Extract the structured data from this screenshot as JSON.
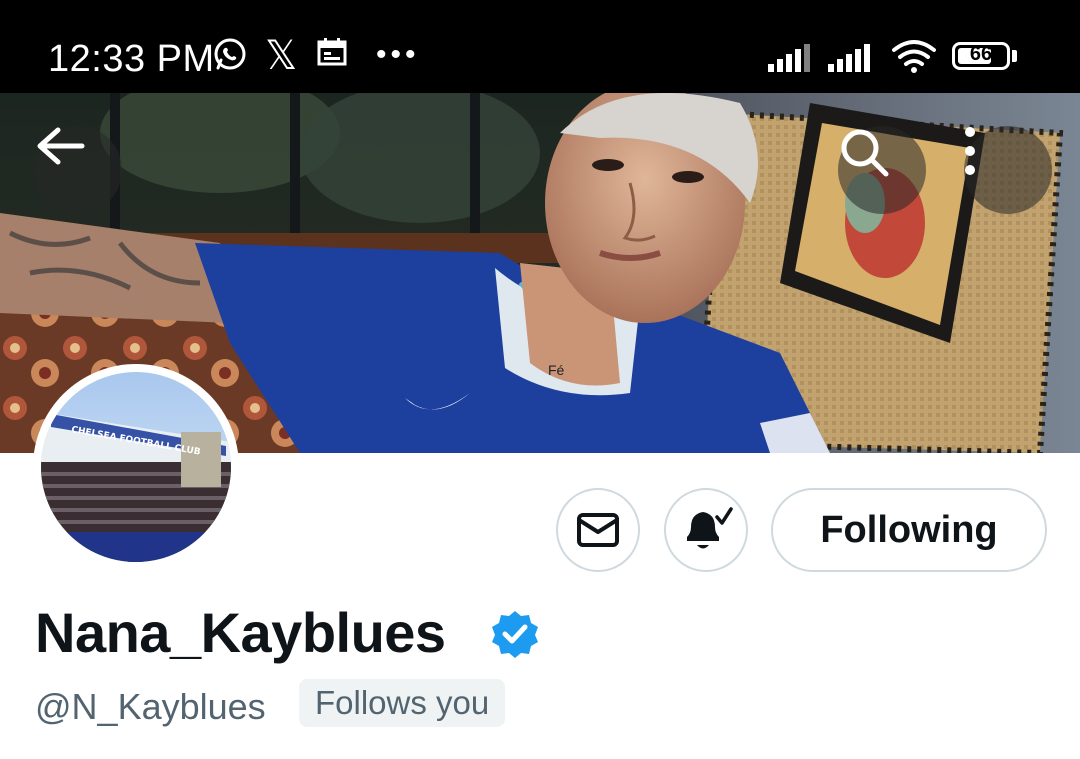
{
  "status_bar": {
    "time": "12:33 PM",
    "battery": "66",
    "icons": [
      "whatsapp-icon",
      "x-icon",
      "calendar-icon",
      "more-notifications-icon",
      "signal-icon",
      "signal-icon",
      "wifi-icon",
      "battery-icon"
    ]
  },
  "nav": {
    "back_icon": "arrow-left-icon",
    "search_icon": "search-icon",
    "more_icon": "vertical-dots-icon"
  },
  "profile": {
    "display_name": "Nana_Kayblues",
    "handle": "@N_Kayblues",
    "follows_you": "Follows you",
    "verified_color": "#1d9bf0"
  },
  "actions": {
    "message_icon": "envelope-icon",
    "notification_icon": "bell-check-icon",
    "following_label": "Following"
  },
  "avatar": {
    "stadium_text": "CHELSEA FOOTBALL CLUB"
  },
  "banner": {
    "shirt_text": "Fé"
  },
  "colors": {
    "text_primary": "#0f1419",
    "text_secondary": "#536471",
    "border": "#cfd9de",
    "badge_bg": "#eff3f4",
    "verified": "#1d9bf0",
    "jersey": "#1d3f9e"
  }
}
